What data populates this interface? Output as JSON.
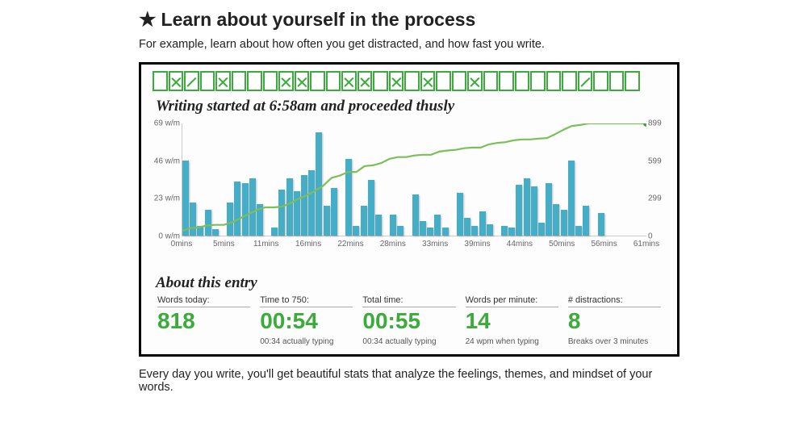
{
  "heading": "Learn about yourself in the process",
  "subtitle": "For example, learn about how often you get distracted, and how fast you write.",
  "streak_days": [
    "blank",
    "x",
    "slash",
    "blank",
    "x",
    "blank",
    "blank",
    "blank",
    "x",
    "x",
    "blank",
    "blank",
    "x",
    "x",
    "blank",
    "x",
    "blank",
    "x",
    "blank",
    "blank",
    "x",
    "blank",
    "blank",
    "blank",
    "blank",
    "blank",
    "blank",
    "slash",
    "blank",
    "blank",
    "blank"
  ],
  "chart_title": "Writing started at 6:58am and proceeded thusly",
  "chart_data": {
    "type": "bar+line",
    "x_unit": "minutes",
    "x_ticks": [
      "0mins",
      "5mins",
      "11mins",
      "16mins",
      "22mins",
      "28mins",
      "33mins",
      "39mins",
      "44mins",
      "50mins",
      "56mins",
      "61mins"
    ],
    "y_left_label": "w/m",
    "y_left_ticks": [
      0,
      23,
      46,
      69
    ],
    "y_left_ticks_labels": [
      "0 w/m",
      "23 w/m",
      "46 w/m",
      "69 w/m"
    ],
    "y_right_label": "words",
    "y_right_ticks": [
      0,
      299,
      599,
      899
    ],
    "bars_wpm": [
      46,
      20,
      6,
      16,
      4,
      0,
      20,
      33,
      32,
      35,
      19,
      0,
      5,
      28,
      35,
      27,
      37,
      40,
      63,
      18,
      29,
      0,
      47,
      6,
      18,
      34,
      13,
      0,
      13,
      6,
      0,
      25,
      9,
      5,
      13,
      5,
      0,
      26,
      11,
      6,
      15,
      7,
      0,
      6,
      5,
      31,
      35,
      30,
      8,
      32,
      19,
      16,
      46,
      6,
      18,
      0,
      14,
      0,
      0,
      0,
      0
    ],
    "line_cumulative_words": [
      46,
      66,
      72,
      88,
      92,
      92,
      112,
      145,
      177,
      212,
      231,
      231,
      236,
      264,
      299,
      326,
      363,
      403,
      466,
      484,
      513,
      513,
      560,
      566,
      584,
      618,
      631,
      631,
      644,
      650,
      650,
      675,
      684,
      689,
      702,
      707,
      707,
      733,
      744,
      750,
      765,
      772,
      772,
      778,
      783,
      814,
      849,
      879,
      887,
      919,
      938,
      954,
      1000,
      1006,
      1024,
      1024,
      1038
    ],
    "chart_y_right_max": 899,
    "chart_y_left_max": 69,
    "title": "Writing started at 6:58am and proceeded thusly"
  },
  "about_title": "About this entry",
  "stats": [
    {
      "label": "Words today:",
      "value": "818",
      "note": ""
    },
    {
      "label": "Time to 750:",
      "value": "00:54",
      "note": "00:34 actually typing"
    },
    {
      "label": "Total time:",
      "value": "00:55",
      "note": "00:34 actually typing"
    },
    {
      "label": "Words per minute:",
      "value": "14",
      "note": "24 wpm when typing"
    },
    {
      "label": "# distractions:",
      "value": "8",
      "note": "Breaks over 3 minutes"
    }
  ],
  "caption": "Every day you write, you'll get beautiful stats that analyze the feelings, themes, and mindset of your words."
}
